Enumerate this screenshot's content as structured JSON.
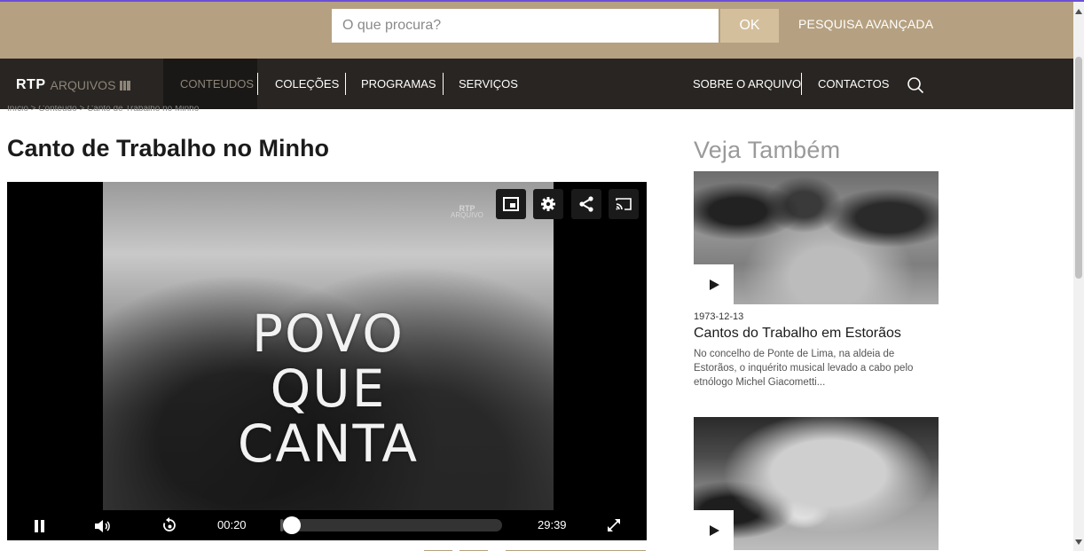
{
  "search": {
    "placeholder": "O que procura?",
    "ok_label": "OK",
    "advanced_label": "PESQUISA AVANÇADA"
  },
  "brand": {
    "rtp": "RTP",
    "arquivos": "ARQUIVOS"
  },
  "nav": {
    "items": [
      {
        "label": "CONTEUDOS",
        "active": true
      },
      {
        "label": "COLEÇÕES"
      },
      {
        "label": "PROGRAMAS"
      },
      {
        "label": "SERVIÇOS"
      },
      {
        "label": "SOBRE O ARQUIVO"
      },
      {
        "label": "CONTACTOS"
      }
    ],
    "search_icon": "search-icon"
  },
  "breadcrumb": "Início > Conteúdo > Canto de Trabalho no Minho",
  "page": {
    "title": "Canto de Trabalho no Minho"
  },
  "player": {
    "video_text": [
      "POVO",
      "QUE",
      "CANTA"
    ],
    "watermark_rtp": "RTP",
    "watermark_arquivo": "ARQUIVO",
    "buttons": [
      "pip-icon",
      "settings-icon",
      "share-icon",
      "cast-icon"
    ],
    "current_time": "00:20",
    "duration": "29:39",
    "progress_fraction": 0.011
  },
  "sidebar": {
    "heading": "Veja Também",
    "cards": [
      {
        "date": "1973-12-13",
        "title": "Cantos do Trabalho em Estorãos",
        "description": "No concelho de Ponte de Lima, na aldeia de Estorãos, o inquérito musical levado a cabo pelo etnólogo Michel Giacometti..."
      },
      {
        "date": "",
        "title": "",
        "description": ""
      }
    ]
  },
  "colors": {
    "topbar": "#b5a181",
    "navbar": "#282522",
    "ok_button": "#d4bf9d",
    "accent_muted": "#8d8578"
  }
}
